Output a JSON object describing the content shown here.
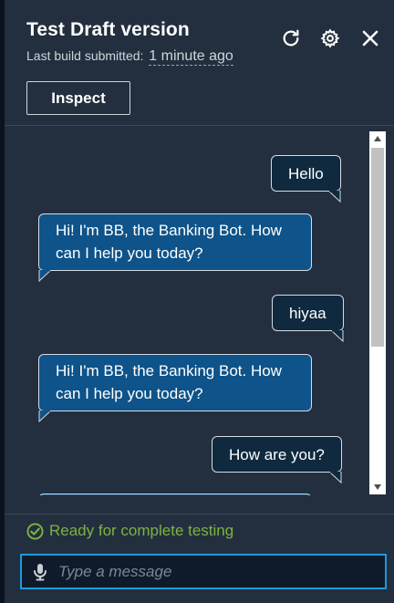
{
  "header": {
    "title": "Test Draft version",
    "subtitle_label": "Last build submitted:",
    "subtitle_time": "1 minute ago",
    "inspect_label": "Inspect",
    "icons": [
      "refresh-icon",
      "gear-icon",
      "close-icon"
    ]
  },
  "messages": [
    {
      "from": "user",
      "text": "Hello"
    },
    {
      "from": "bot",
      "text": "Hi! I'm BB, the Banking Bot. How can I help you today?"
    },
    {
      "from": "user",
      "text": "hiyaa"
    },
    {
      "from": "bot",
      "text": "Hi! I'm BB, the Banking Bot. How can I help you today?"
    },
    {
      "from": "user",
      "text": "How are you?"
    }
  ],
  "status": {
    "text": "Ready for complete testing",
    "color": "#7cb342"
  },
  "input": {
    "placeholder": "Type a message",
    "value": ""
  },
  "colors": {
    "panel": "#232f3e",
    "bot_bubble": "#0e5389",
    "user_bubble": "#0f2a3f",
    "input_focus": "#1b9bd8"
  }
}
